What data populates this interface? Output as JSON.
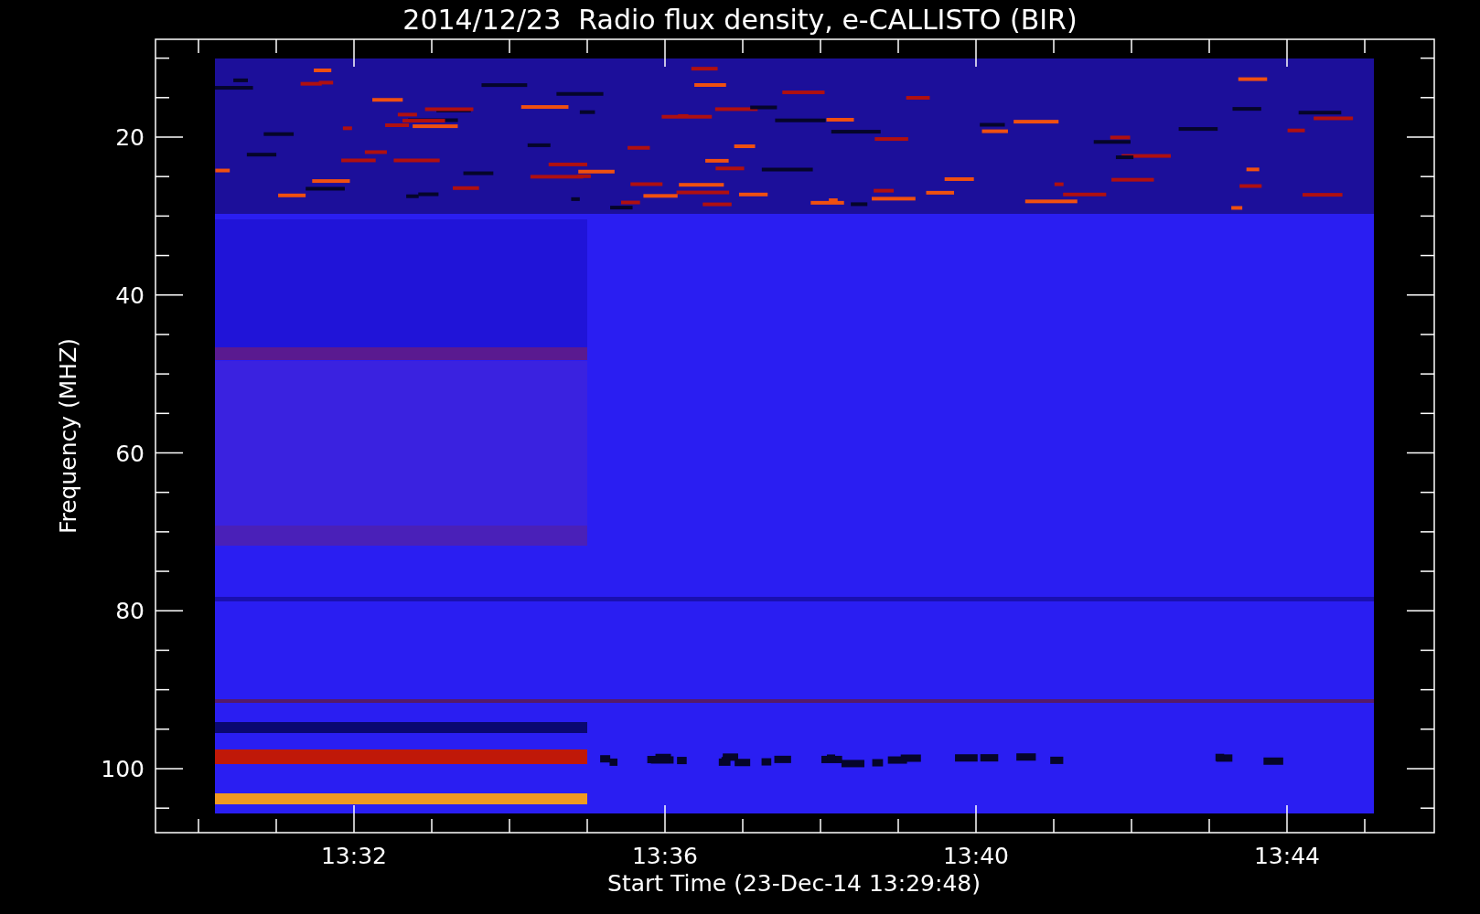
{
  "title": "2014/12/23  Radio flux density, e-CALLISTO (BIR)",
  "y_axis": {
    "label": "Frequency (MHZ)",
    "ticks": [
      "20",
      "40",
      "60",
      "80",
      "100"
    ]
  },
  "x_axis": {
    "label": "Start Time (23-Dec-14 13:29:48)",
    "ticks": [
      "13:32",
      "13:36",
      "13:40",
      "13:44"
    ]
  }
}
